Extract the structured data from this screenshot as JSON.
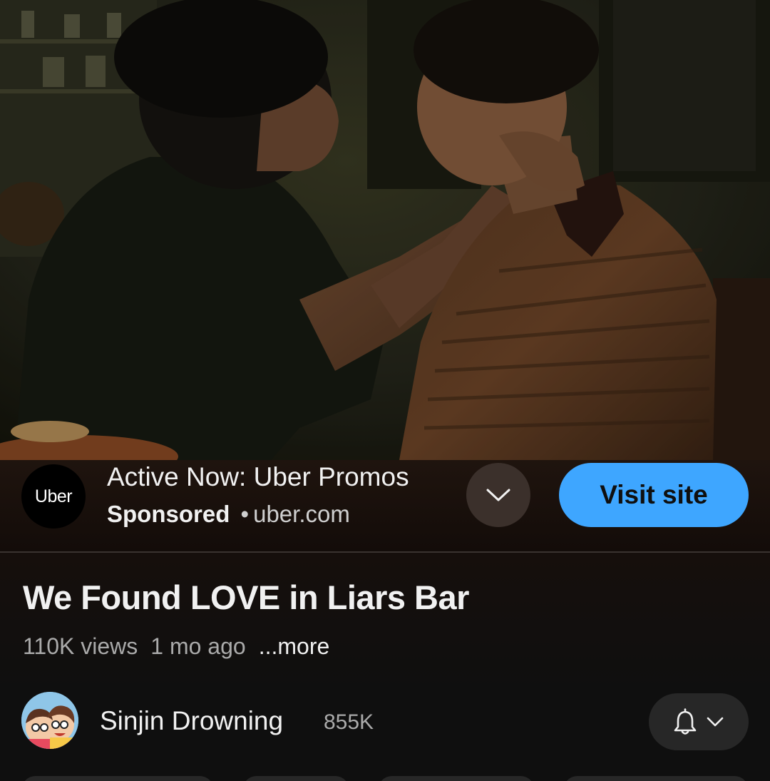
{
  "ad": {
    "logo_text": "Uber",
    "title": "Active Now: Uber Promos",
    "sponsored_label": "Sponsored",
    "separator": "•",
    "domain": "uber.com",
    "expand_icon": "chevron-down-icon",
    "cta_label": "Visit site",
    "cta_color": "#3ea6ff"
  },
  "video": {
    "title": "We Found LOVE in Liars Bar",
    "views": "110K views",
    "age": "1 mo ago",
    "more_label": "...more"
  },
  "channel": {
    "name": "Sinjin Drowning",
    "subscribers": "855K",
    "bell_icon": "bell-icon",
    "dropdown_icon": "chevron-down-icon"
  }
}
